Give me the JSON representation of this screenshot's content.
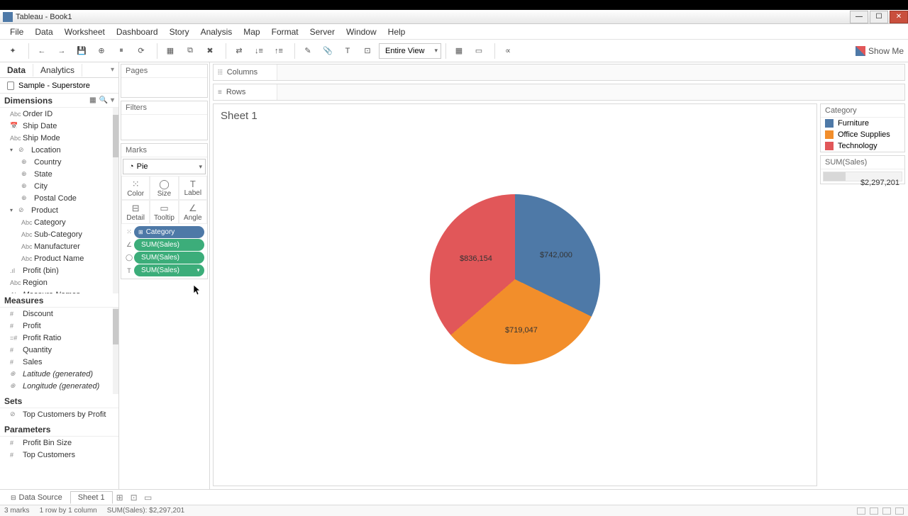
{
  "window": {
    "title": "Tableau - Book1"
  },
  "menu": [
    "File",
    "Data",
    "Worksheet",
    "Dashboard",
    "Story",
    "Analysis",
    "Map",
    "Format",
    "Server",
    "Window",
    "Help"
  ],
  "toolbar": {
    "fit_mode": "Entire View",
    "show_me": "Show Me"
  },
  "data_pane": {
    "tabs": {
      "data": "Data",
      "analytics": "Analytics"
    },
    "datasource": "Sample - Superstore",
    "dimensions_label": "Dimensions",
    "dimensions": {
      "root": [
        {
          "name": "Order ID",
          "icon": "Abc"
        },
        {
          "name": "Ship Date",
          "icon": "📅"
        },
        {
          "name": "Ship Mode",
          "icon": "Abc"
        }
      ],
      "location": {
        "label": "Location",
        "children": [
          {
            "name": "Country",
            "icon": "⊕"
          },
          {
            "name": "State",
            "icon": "⊕"
          },
          {
            "name": "City",
            "icon": "⊕"
          },
          {
            "name": "Postal Code",
            "icon": "⊕"
          }
        ]
      },
      "product": {
        "label": "Product",
        "children": [
          {
            "name": "Category",
            "icon": "Abc"
          },
          {
            "name": "Sub-Category",
            "icon": "Abc"
          },
          {
            "name": "Manufacturer",
            "icon": "Abc"
          },
          {
            "name": "Product Name",
            "icon": "Abc"
          }
        ]
      },
      "tail": [
        {
          "name": "Profit (bin)",
          "icon": ".ıl"
        },
        {
          "name": "Region",
          "icon": "Abc"
        },
        {
          "name": "Measure Names",
          "icon": "Abc",
          "italic": true
        }
      ]
    },
    "measures_label": "Measures",
    "measures": [
      {
        "name": "Discount",
        "icon": "#"
      },
      {
        "name": "Profit",
        "icon": "#"
      },
      {
        "name": "Profit Ratio",
        "icon": "=#"
      },
      {
        "name": "Quantity",
        "icon": "#"
      },
      {
        "name": "Sales",
        "icon": "#"
      },
      {
        "name": "Latitude (generated)",
        "icon": "⊕",
        "italic": true
      },
      {
        "name": "Longitude (generated)",
        "icon": "⊕",
        "italic": true
      }
    ],
    "sets_label": "Sets",
    "sets": [
      {
        "name": "Top Customers by Profit",
        "icon": "⊘"
      }
    ],
    "parameters_label": "Parameters",
    "parameters": [
      {
        "name": "Profit Bin Size",
        "icon": "#"
      },
      {
        "name": "Top Customers",
        "icon": "#"
      }
    ]
  },
  "cards": {
    "pages": "Pages",
    "filters": "Filters",
    "marks": "Marks",
    "mark_type": "Pie",
    "marktargets": {
      "color": "Color",
      "size": "Size",
      "label": "Label",
      "detail": "Detail",
      "tooltip": "Tooltip",
      "angle": "Angle"
    },
    "pills": [
      {
        "icon": "⊞",
        "label": "Category",
        "color": "blue"
      },
      {
        "icon": "∠",
        "label": "SUM(Sales)",
        "color": "green"
      },
      {
        "icon": "◯",
        "label": "SUM(Sales)",
        "color": "green"
      },
      {
        "icon": "T",
        "label": "SUM(Sales)",
        "color": "green",
        "dropdown": true
      }
    ]
  },
  "shelves": {
    "columns": "Columns",
    "rows": "Rows"
  },
  "viz": {
    "title": "Sheet 1",
    "labels": {
      "tech": "$836,154",
      "furn": "$742,000",
      "off": "$719,047"
    }
  },
  "legend": {
    "category": "Category",
    "items": [
      {
        "label": "Furniture",
        "color": "#4e79a7"
      },
      {
        "label": "Office Supplies",
        "color": "#f28e2b"
      },
      {
        "label": "Technology",
        "color": "#e15759"
      }
    ],
    "sum_label": "SUM(Sales)",
    "sum_value": "$2,297,201"
  },
  "bottom": {
    "data_source": "Data Source",
    "sheet": "Sheet 1"
  },
  "status": {
    "marks": "3 marks",
    "rows": "1 row by 1 column",
    "sum": "SUM(Sales): $2,297,201"
  },
  "chart_data": {
    "type": "pie",
    "title": "Sheet 1",
    "categories": [
      "Furniture",
      "Office Supplies",
      "Technology"
    ],
    "values": [
      742000,
      719047,
      836154
    ],
    "value_labels": [
      "$742,000",
      "$719,047",
      "$836,154"
    ],
    "colors": [
      "#4e79a7",
      "#f28e2b",
      "#e15759"
    ],
    "total": 2297201
  }
}
